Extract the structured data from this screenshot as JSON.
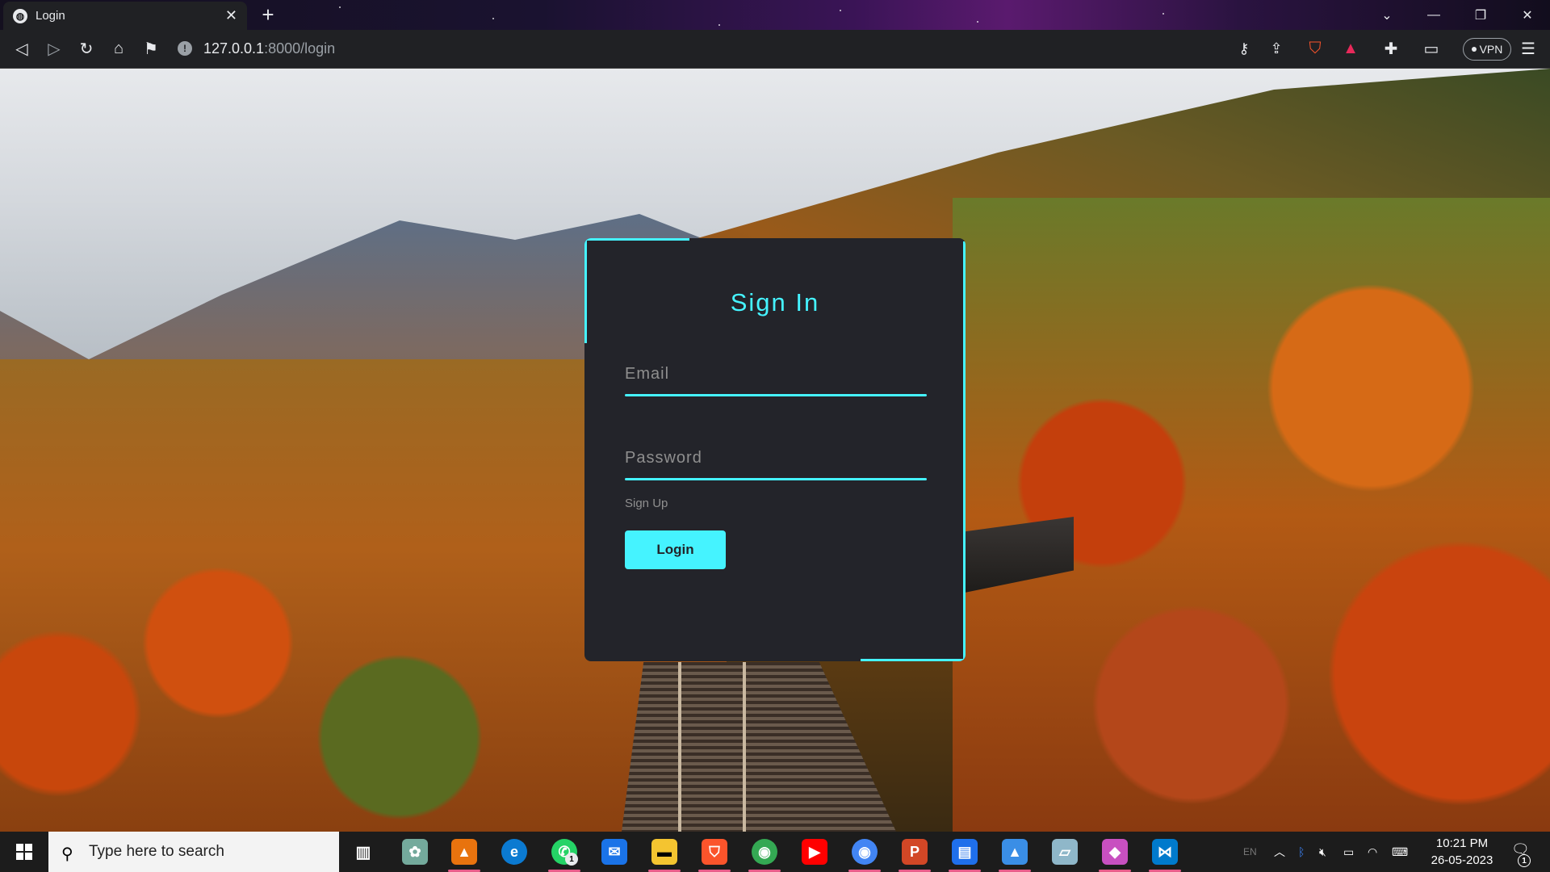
{
  "browser": {
    "tab_title": "Login",
    "favicon_icon": "globe-icon",
    "url_host": "127.0.0.1",
    "url_path": ":8000/login",
    "vpn_label": "VPN"
  },
  "login": {
    "heading": "Sign In",
    "email_placeholder": "Email",
    "password_placeholder": "Password",
    "signup_link": "Sign Up",
    "login_button": "Login",
    "accent_color": "#45f3ff",
    "card_color": "#23242a"
  },
  "taskbar": {
    "search_placeholder": "Type here to search",
    "whatsapp_badge": "1",
    "language": "EN",
    "time": "10:21 PM",
    "date": "26-05-2023",
    "notification_count": "1"
  }
}
